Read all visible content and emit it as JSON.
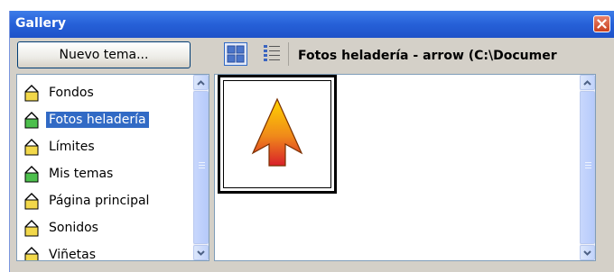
{
  "window": {
    "title": "Gallery"
  },
  "toolbar": {
    "new_theme_label": "Nuevo tema...",
    "path_title": "Fotos heladería - arrow (C:\\Documer"
  },
  "themes": {
    "items": [
      {
        "label": "Fondos",
        "icon": "folder-yellow-icon",
        "selected": false
      },
      {
        "label": "Fotos heladería",
        "icon": "folder-green-icon",
        "selected": true
      },
      {
        "label": "Límites",
        "icon": "folder-yellow-icon",
        "selected": false
      },
      {
        "label": "Mis temas",
        "icon": "folder-green-icon",
        "selected": false
      },
      {
        "label": "Página principal",
        "icon": "folder-yellow-icon",
        "selected": false
      },
      {
        "label": "Sonidos",
        "icon": "folder-yellow-icon",
        "selected": false
      },
      {
        "label": "Viñetas",
        "icon": "folder-yellow-icon",
        "selected": false
      }
    ]
  },
  "preview": {
    "items": [
      {
        "icon": "arrow-up-icon"
      }
    ]
  },
  "colors": {
    "title_bar": "#2660d8",
    "selection": "#316ac5",
    "folder_yellow": "#f2d84a",
    "folder_green": "#4cbf4c",
    "arrow_top": "#ffd400",
    "arrow_bottom": "#d8202a"
  }
}
